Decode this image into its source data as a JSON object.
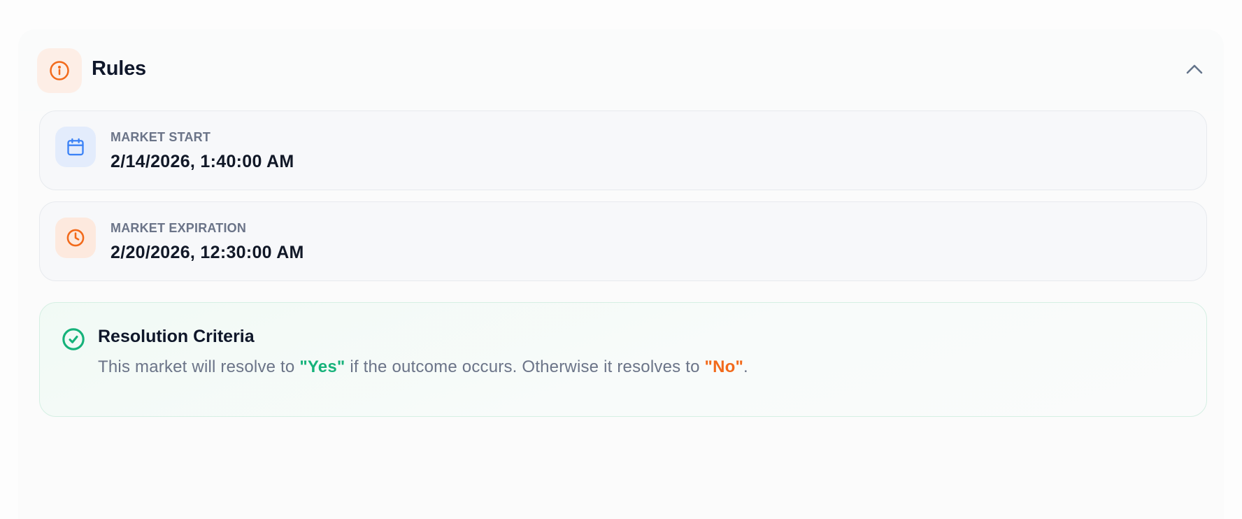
{
  "rules": {
    "title": "Rules",
    "header_icon": "info-circle-icon",
    "collapse_icon": "chevron-up-icon"
  },
  "market_start": {
    "label": "MARKET START",
    "value": "2/14/2026, 1:40:00 AM",
    "icon": "calendar-icon"
  },
  "market_expiration": {
    "label": "MARKET EXPIRATION",
    "value": "2/20/2026, 12:30:00 AM",
    "icon": "clock-icon"
  },
  "resolution": {
    "title": "Resolution Criteria",
    "icon": "check-circle-icon",
    "text_before": "This market will resolve to ",
    "yes_label": "\"Yes\"",
    "text_middle": " if the outcome occurs. Otherwise it resolves to ",
    "no_label": "\"No\"",
    "text_after": "."
  },
  "colors": {
    "accent_orange": "#f26a1b",
    "accent_green": "#16b27a",
    "accent_blue": "#3b82f6"
  }
}
